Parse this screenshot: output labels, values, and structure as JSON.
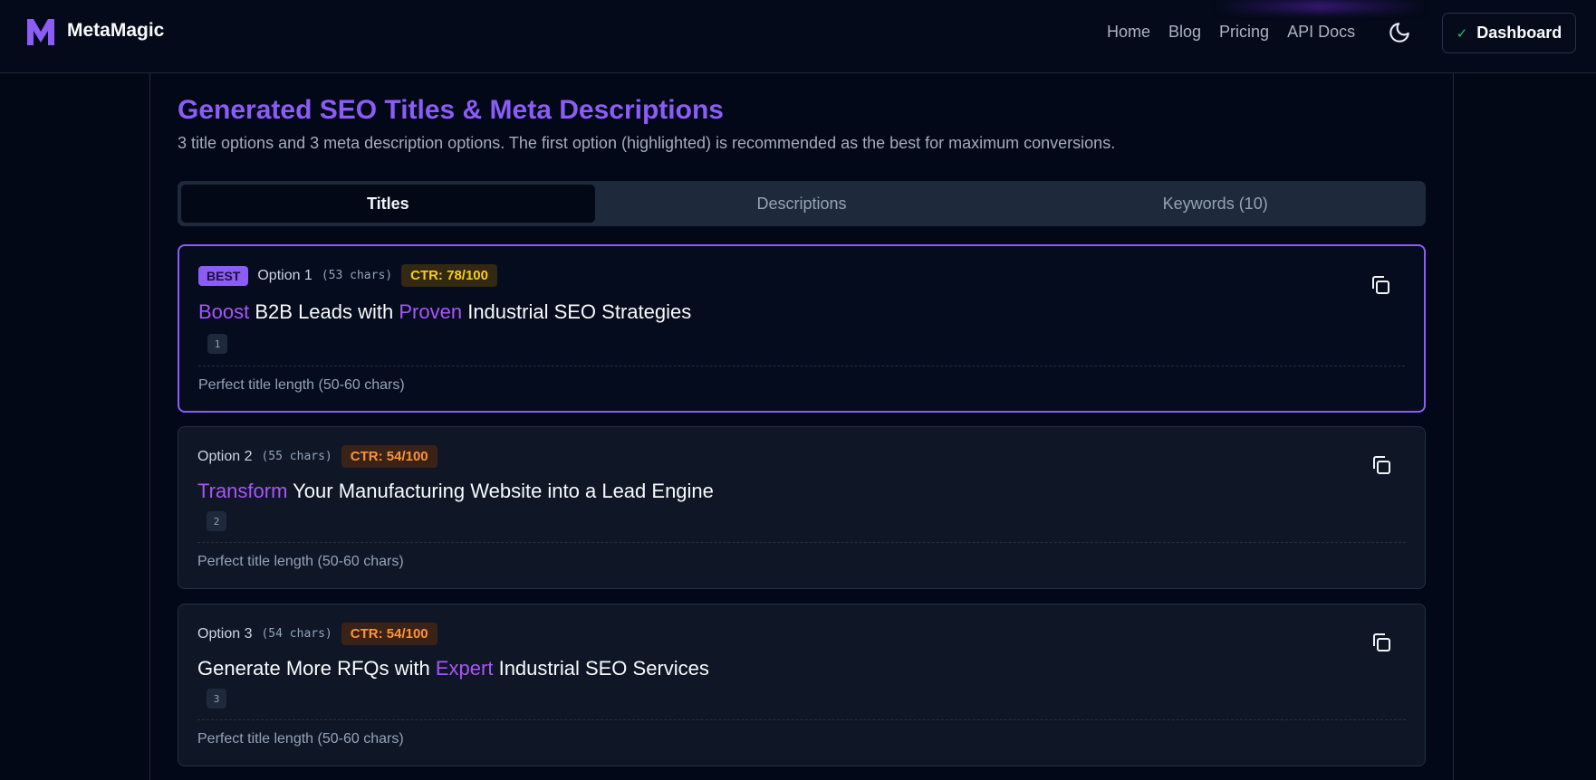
{
  "header": {
    "brand": "MetaMagic",
    "nav": [
      "Home",
      "Blog",
      "Pricing",
      "API Docs"
    ],
    "dashboard_label": "Dashboard"
  },
  "main": {
    "title": "Generated SEO Titles & Meta Descriptions",
    "subtitle": "3 title options and 3 meta description options. The first option (highlighted) is recommended as the best for maximum conversions.",
    "tabs": [
      "Titles",
      "Descriptions",
      "Keywords (10)"
    ],
    "active_tab": "Titles",
    "options": [
      {
        "badge": "BEST",
        "label": "Option 1",
        "chars": "(53 chars)",
        "ctr": "CTR: 78/100",
        "title_parts": [
          {
            "text": "Boost",
            "hl": true
          },
          {
            "text": " B2B Leads with ",
            "hl": false
          },
          {
            "text": "Proven",
            "hl": true
          },
          {
            "text": " Industrial SEO Strategies",
            "hl": false
          }
        ],
        "number": "1",
        "note": "Perfect title length (50-60 chars)"
      },
      {
        "label": "Option 2",
        "chars": "(55 chars)",
        "ctr": "CTR: 54/100",
        "title_parts": [
          {
            "text": "Transform",
            "hl": true
          },
          {
            "text": " Your Manufacturing Website into a Lead Engine",
            "hl": false
          }
        ],
        "number": "2",
        "note": "Perfect title length (50-60 chars)"
      },
      {
        "label": "Option 3",
        "chars": "(54 chars)",
        "ctr": "CTR: 54/100",
        "title_parts": [
          {
            "text": "Generate More RFQs with ",
            "hl": false
          },
          {
            "text": "Expert",
            "hl": true
          },
          {
            "text": " Industrial SEO Services",
            "hl": false
          }
        ],
        "number": "3",
        "note": "Perfect title length (50-60 chars)"
      }
    ]
  },
  "colors": {
    "accent": "#8b5cf6",
    "highlight": "#a855f7",
    "ctr_best": "#facc15",
    "ctr_other": "#fb923c",
    "background": "#030817"
  },
  "icons": [
    "logo-m-icon",
    "moon-icon",
    "check-icon",
    "copy-icon"
  ]
}
